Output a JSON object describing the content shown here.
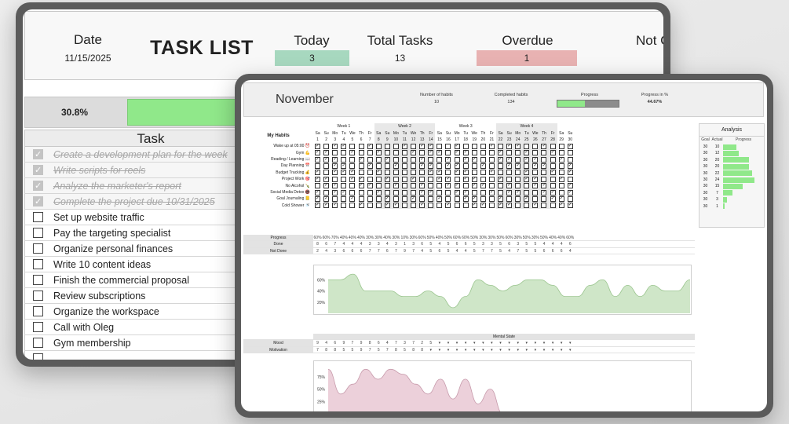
{
  "task_list": {
    "date_label": "Date",
    "date_value": "11/15/2025",
    "title": "TASK LIST",
    "today_label": "Today",
    "today_value": "3",
    "total_label": "Total Tasks",
    "total_value": "13",
    "overdue_label": "Overdue",
    "overdue_value": "1",
    "not_label": "Not C",
    "progress_text": "30.8%",
    "progress_fraction": 0.308,
    "task_header": "Task",
    "tasks": [
      {
        "text": "Create a development plan for the week",
        "done": true
      },
      {
        "text": "Write scripts for reels",
        "done": true
      },
      {
        "text": "Analyze the marketer's report",
        "done": true
      },
      {
        "text": "Complete the project due 10/31/2025",
        "done": true
      },
      {
        "text": "Set up website traffic",
        "done": false
      },
      {
        "text": "Pay the targeting specialist",
        "done": false
      },
      {
        "text": "Organize personal finances",
        "done": false
      },
      {
        "text": "Write 10 content ideas",
        "done": false
      },
      {
        "text": "Finish the commercial proposal",
        "done": false
      },
      {
        "text": "Review subscriptions",
        "done": false
      },
      {
        "text": "Organize the workspace",
        "done": false
      },
      {
        "text": "Call with Oleg",
        "done": false
      },
      {
        "text": "Gym membership",
        "done": false
      }
    ]
  },
  "habit_tracker": {
    "month": "November",
    "habits_count_label": "Number of habits",
    "habits_count": "10",
    "completed_label": "Completed habits",
    "completed": "134",
    "progress_label": "Progress",
    "progress_fraction": 0.4467,
    "percent_label": "Progress in %",
    "percent": "44.67%",
    "my_habits_label": "My Habits",
    "weeks": [
      "Week 1",
      "Week 2",
      "Week 3",
      "Week 4"
    ],
    "day_names": [
      "Sa",
      "Su",
      "Mo",
      "Tu",
      "We",
      "Th",
      "Fr",
      "Sa",
      "Su",
      "Mo",
      "Tu",
      "We",
      "Th",
      "Fr",
      "Sa",
      "Su",
      "Mo",
      "Tu",
      "We",
      "Th",
      "Fr",
      "Sa",
      "Su",
      "Mo",
      "Tu",
      "We",
      "Th",
      "Fr",
      "Sa",
      "Su"
    ],
    "day_numbers": [
      "1",
      "2",
      "3",
      "4",
      "5",
      "6",
      "7",
      "8",
      "9",
      "10",
      "11",
      "12",
      "13",
      "14",
      "15",
      "16",
      "17",
      "18",
      "19",
      "20",
      "21",
      "22",
      "23",
      "24",
      "25",
      "26",
      "27",
      "28",
      "29",
      "30"
    ],
    "habits": [
      "Wake up at 05:00 ⏰",
      "Gym 💪",
      "Reading / Learning 📖",
      "Day Planning 📅",
      "Budget Tracking 💰",
      "Project Work 🎯",
      "No Alcohol 🍾",
      "Social Media Detox 📵",
      "Goal Journaling 📒",
      "Cold Shower 🚿"
    ],
    "analysis_title": "Analysis",
    "analysis_headers": [
      "Goal",
      "Actual",
      "Progress"
    ],
    "analysis_goal": [
      "30",
      "30",
      "30",
      "30",
      "30",
      "30",
      "30",
      "30",
      "30",
      "30"
    ],
    "analysis_actual": [
      "10",
      "12",
      "20",
      "20",
      "22",
      "24",
      "15",
      "7",
      "3",
      "1"
    ],
    "progress_row_label": "Progress",
    "done_row_label": "Done",
    "notdone_row_label": "Not Done",
    "progress_values": [
      "60%",
      "60%",
      "70%",
      "40%",
      "40%",
      "40%",
      "30%",
      "30%",
      "40%",
      "30%",
      "10%",
      "30%",
      "60%",
      "50%",
      "40%",
      "50%",
      "60%",
      "60%",
      "50%",
      "30%",
      "30%",
      "50%",
      "60%",
      "30%",
      "50%",
      "30%",
      "50%",
      "40%",
      "40%",
      "60%"
    ],
    "done_values": [
      "8",
      "6",
      "7",
      "4",
      "4",
      "4",
      "3",
      "3",
      "4",
      "3",
      "1",
      "3",
      "6",
      "5",
      "4",
      "5",
      "6",
      "6",
      "5",
      "3",
      "3",
      "5",
      "6",
      "3",
      "5",
      "5",
      "4",
      "4",
      "4",
      "6"
    ],
    "notdone_values": [
      "2",
      "4",
      "3",
      "6",
      "6",
      "6",
      "7",
      "7",
      "6",
      "7",
      "9",
      "7",
      "4",
      "5",
      "6",
      "5",
      "4",
      "4",
      "5",
      "7",
      "7",
      "5",
      "4",
      "7",
      "5",
      "5",
      "6",
      "6",
      "6",
      "4"
    ],
    "chart1_ticks": [
      "60%",
      "40%",
      "20%"
    ],
    "mental_title": "Mental State",
    "mood_label": "Mood",
    "motivation_label": "Motivation",
    "mood_values": [
      "9",
      "4",
      "6",
      "9",
      "7",
      "9",
      "8",
      "6",
      "4",
      "7",
      "3",
      "7",
      "2",
      "5"
    ],
    "motivation_values": [
      "7",
      "8",
      "8",
      "5",
      "5",
      "9",
      "7",
      "5",
      "7",
      "8",
      "5",
      "8",
      "8"
    ],
    "chart2_ticks": [
      "75%",
      "50%",
      "25%"
    ],
    "colors": {
      "green": "#90e88a",
      "chart_green": "#cfe6c8",
      "chart_pink": "#ecd0da",
      "today": "#a7d8bf",
      "overdue": "#e8b2b2"
    }
  }
}
